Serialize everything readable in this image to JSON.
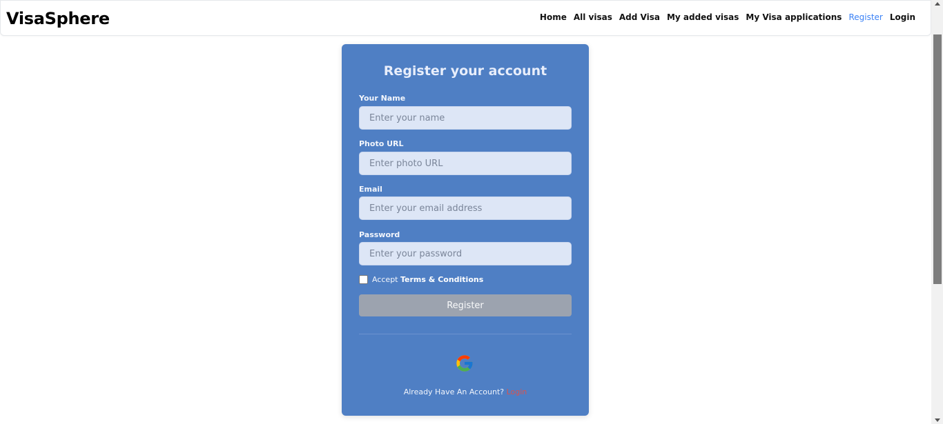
{
  "brand": "VisaSphere",
  "nav": [
    {
      "label": "Home",
      "active": false
    },
    {
      "label": "All visas",
      "active": false
    },
    {
      "label": "Add Visa",
      "active": false
    },
    {
      "label": "My added visas",
      "active": false
    },
    {
      "label": "My Visa applications",
      "active": false
    },
    {
      "label": "Register",
      "active": true
    },
    {
      "label": "Login",
      "active": false
    }
  ],
  "form": {
    "title": "Register your account",
    "fields": [
      {
        "label": "Your Name",
        "placeholder": "Enter your name",
        "value": ""
      },
      {
        "label": "Photo URL",
        "placeholder": "Enter photo URL",
        "value": ""
      },
      {
        "label": "Email",
        "placeholder": "Enter your email address",
        "value": ""
      },
      {
        "label": "Password",
        "placeholder": "Enter your password",
        "value": ""
      }
    ],
    "terms_prefix": "Accept",
    "terms_link": "Terms & Conditions",
    "terms_checked": false,
    "submit_label": "Register",
    "google_icon": "google-icon",
    "footer_text": "Already Have An Account?",
    "footer_link": "Login"
  },
  "colors": {
    "card_bg": "#4f7fc4",
    "nav_active": "#3b82f6",
    "submit_disabled": "#9ca3af",
    "login_link": "#d9534f"
  }
}
